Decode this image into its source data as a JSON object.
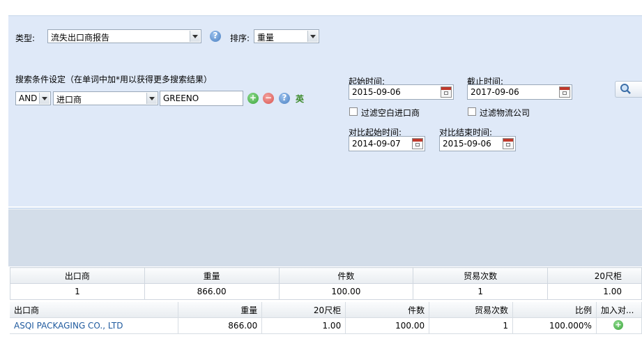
{
  "toolbar": {
    "type_label": "类型:",
    "type_value": "流失出口商报告",
    "sort_label": "排序:",
    "sort_value": "重量"
  },
  "search": {
    "conditions_title": "搜索条件设定（在单词中加*用以获得更多搜索结果）",
    "logic_value": "AND",
    "field_value": "进口商",
    "keyword_value": "GREENO",
    "lang_toggle": "英",
    "start_label": "起始时间:",
    "start_value": "2015-09-06",
    "end_label": "截止时间:",
    "end_value": "2017-09-06",
    "filter_blank_importer": "过滤空白进口商",
    "filter_logistics": "过滤物流公司",
    "cmp_start_label": "对比起始时间:",
    "cmp_start_value": "2014-09-07",
    "cmp_end_label": "对比结束时间:",
    "cmp_end_value": "2015-09-06"
  },
  "summary": {
    "headers": [
      "出口商",
      "重量",
      "件数",
      "贸易次数",
      "20尺柜"
    ],
    "row": [
      "1",
      "866.00",
      "100.00",
      "1",
      "1.00"
    ]
  },
  "detail": {
    "headers": [
      "出口商",
      "重量",
      "20尺柜",
      "件数",
      "贸易次数",
      "比例",
      "加入对..."
    ],
    "rows": [
      [
        "ASQI PACKAGING CO., LTD",
        "866.00",
        "1.00",
        "100.00",
        "1",
        "100.000%"
      ]
    ]
  },
  "colors": {
    "panel_bg": "#dfe9f8",
    "link": "#1f5a9e",
    "add_green": "#3aa53a",
    "remove_red": "#d9534f",
    "help_blue": "#4a7fc1"
  },
  "icons": {
    "help": "help-icon",
    "add": "add-icon",
    "remove": "remove-icon",
    "search": "search-icon",
    "calendar": "calendar-icon"
  }
}
